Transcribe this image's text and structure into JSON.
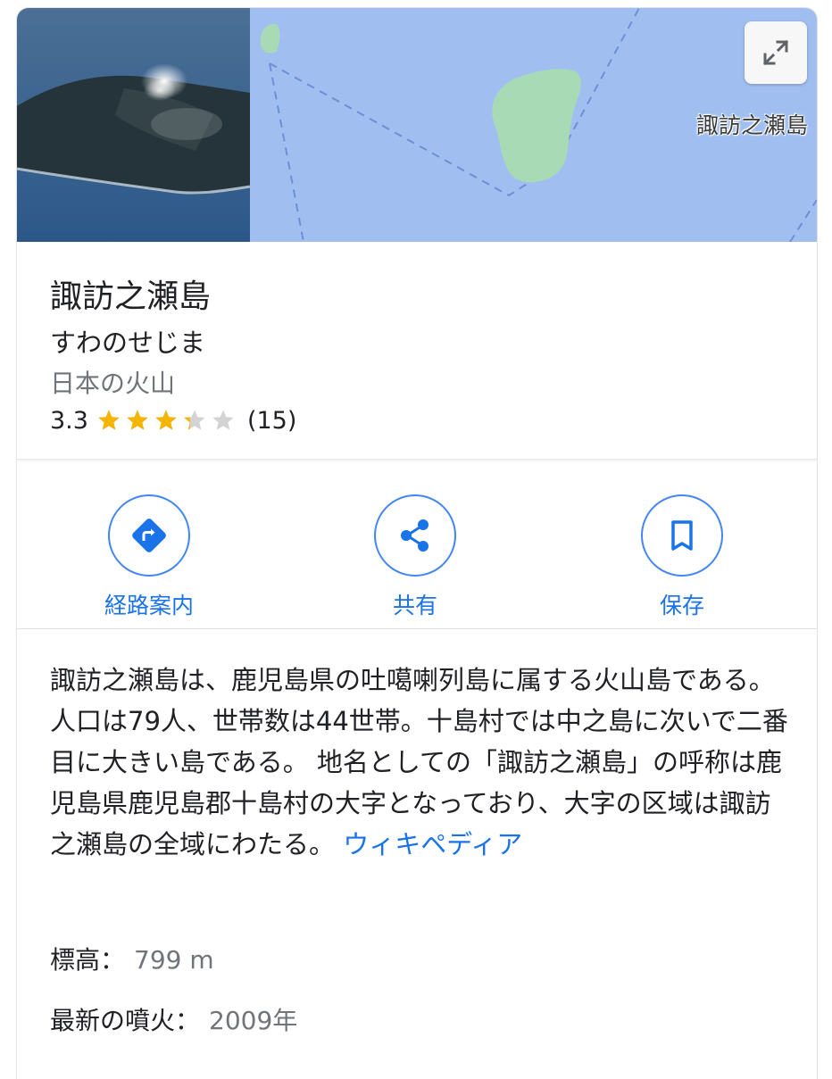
{
  "map": {
    "label": "諏訪之瀬島"
  },
  "place": {
    "title": "諏訪之瀬島",
    "reading": "すわのせじま",
    "category": "日本の火山",
    "rating": "3.3",
    "rating_value": 3.3,
    "rating_max": 5,
    "review_count": "(15)"
  },
  "actions": {
    "directions": "経路案内",
    "share": "共有",
    "save": "保存"
  },
  "description": {
    "text": "諏訪之瀬島は、鹿児島県の吐噶喇列島に属する火山島である。人口は79人、世帯数は44世帯。十島村では中之島に次いで二番目に大きい島である。 地名としての「諏訪之瀬島」の呼称は鹿児島県鹿児島郡十島村の大字となっており、大字の区域は諏訪之瀬島の全域にわたる。 ",
    "source_link": "ウィキペディア"
  },
  "facts": {
    "elevation_label": "標高：",
    "elevation_value": "799 m",
    "eruption_label": "最新の噴火：",
    "eruption_value": "2009年"
  },
  "colors": {
    "accent": "#1a73e8",
    "star": "#f4b400",
    "star_empty": "#d3d3d3",
    "map_water": "#a0bff0",
    "map_land": "#a8dab5"
  },
  "icons": {
    "expand": "expand-icon",
    "directions": "directions-icon",
    "share": "share-icon",
    "save": "bookmark-icon"
  }
}
